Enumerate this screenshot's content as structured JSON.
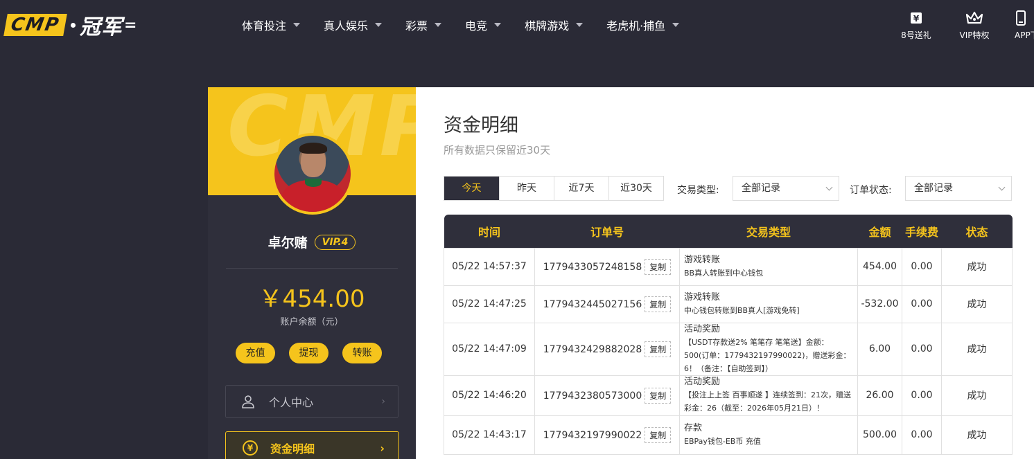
{
  "header": {
    "logo_box": "CMP",
    "logo_text": "冠军",
    "nav": [
      {
        "label": "体育投注"
      },
      {
        "label": "真人娱乐"
      },
      {
        "label": "彩票"
      },
      {
        "label": "电竞"
      },
      {
        "label": "棋牌游戏"
      },
      {
        "label": "老虎机·捕鱼"
      }
    ],
    "right": [
      {
        "label": "8号送礼",
        "icon": "ticket-icon"
      },
      {
        "label": "VIP特权",
        "icon": "crown-icon"
      },
      {
        "label": "APP下",
        "icon": "phone-icon"
      }
    ]
  },
  "profile": {
    "watermark": "CMP",
    "username": "卓尔赌",
    "vip": "VIP.4",
    "balance": "￥454.00",
    "balance_label": "账户余额（元）",
    "actions": {
      "deposit": "充值",
      "withdraw": "提现",
      "transfer": "转账"
    },
    "menu": [
      {
        "label": "个人中心",
        "icon": "user-icon"
      },
      {
        "label": "资金明细",
        "icon": "yuan-icon",
        "icon_glyph": "¥"
      }
    ]
  },
  "ledger": {
    "title": "资金明细",
    "subtitle": "所有数据只保留近30天",
    "tabs": [
      "今天",
      "昨天",
      "近7天",
      "近30天"
    ],
    "active_tab": 0,
    "filters": {
      "type_label": "交易类型:",
      "type_value": "全部记录",
      "status_label": "订单状态:",
      "status_value": "全部记录"
    },
    "columns": [
      "时间",
      "订单号",
      "交易类型",
      "金额",
      "手续费",
      "状态"
    ],
    "copy_label": "复制",
    "rows": [
      {
        "time": "05/22 14:57:37",
        "order": "1779433057248158",
        "type_title": "游戏转账",
        "type_desc": "BB真人转账到中心钱包",
        "amount": "454.00",
        "fee": "0.00",
        "status": "成功"
      },
      {
        "time": "05/22 14:47:25",
        "order": "1779432445027156",
        "type_title": "游戏转账",
        "type_desc": "中心钱包转账到BB真人[游戏免转]",
        "amount": "-532.00",
        "fee": "0.00",
        "status": "成功"
      },
      {
        "time": "05/22 14:47:09",
        "order": "1779432429882028",
        "type_title": "活动奖励",
        "type_desc": "【USDT存款送2% 笔笔存 笔笔送】金额：500(订单：1779432197990022)，赠送彩金：6！（备注：【自助签到】）",
        "amount": "6.00",
        "fee": "0.00",
        "status": "成功"
      },
      {
        "time": "05/22 14:46:20",
        "order": "1779432380573000",
        "type_title": "活动奖励",
        "type_desc": "【投注上上签 百事顺遂 】连续签到：21次，赠送彩金：26（截至：2026年05月21日）！",
        "amount": "26.00",
        "fee": "0.00",
        "status": "成功"
      },
      {
        "time": "05/22 14:43:17",
        "order": "1779432197990022",
        "type_title": "存款",
        "type_desc": "EBPay钱包-EB币 充值",
        "amount": "500.00",
        "fee": "0.00",
        "status": "成功"
      }
    ]
  },
  "colors": {
    "accent": "#f5c41c",
    "dark": "#2f2f3b",
    "success": "#23a03c"
  }
}
